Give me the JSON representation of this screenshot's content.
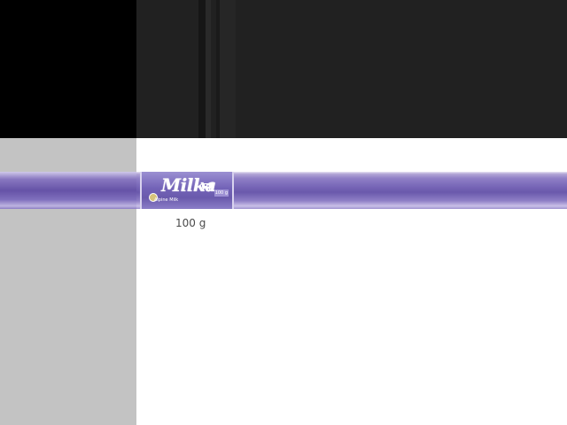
{
  "product": {
    "brand": "Milka",
    "variety": "Alpine Milk",
    "weight": "100 g"
  },
  "colors": {
    "brand_purple": "#7766b7",
    "top_background": "#212121",
    "left_top": "#000000",
    "left_bottom": "#c3c3c3",
    "content_background": "#ffffff",
    "weight_text": "#4a4a4a"
  }
}
